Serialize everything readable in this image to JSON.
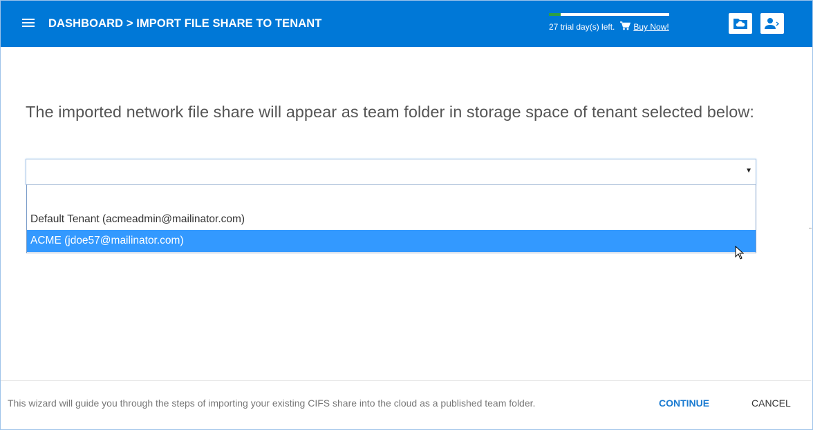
{
  "header": {
    "title": "DASHBOARD > IMPORT FILE SHARE TO TENANT",
    "trial_text": "27 trial day(s) left.",
    "trial_progress": 0.1,
    "buy_label": "Buy Now!",
    "icons": [
      "menu-icon",
      "cart-icon",
      "cloud-folder-icon",
      "user-switch-icon"
    ]
  },
  "main": {
    "prompt": "The imported network file share will appear as team folder in storage space of tenant selected below:",
    "tenant_select": {
      "value": "",
      "options": [
        "",
        "Default Tenant (acmeadmin@mailinator.com)",
        "ACME (jdoe57@mailinator.com)"
      ],
      "highlighted_index": 2
    }
  },
  "footer": {
    "text": "This wizard will guide you through the steps of importing your existing CIFS share into the cloud as a published team folder.",
    "continue_label": "CONTINUE",
    "cancel_label": "CANCEL"
  },
  "colors": {
    "header_bg": "#0078d7",
    "trial_fill": "#2ea043",
    "highlight": "#3399ff",
    "continue": "#1a7bd1"
  }
}
